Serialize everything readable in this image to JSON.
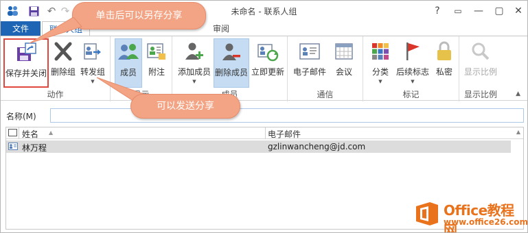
{
  "window": {
    "title": "未命名 - 联系人组",
    "controls": [
      "?",
      "▭",
      "—",
      "▢",
      "✕"
    ]
  },
  "tabs": {
    "file": "文件",
    "active": "联系人组",
    "review": "审阅"
  },
  "ribbon": {
    "groups": {
      "actions": {
        "label": "动作",
        "save_close": "保存并关闭",
        "delete_group": "删除组",
        "forward_group": "转发组"
      },
      "show": {
        "label": "显示",
        "members": "成员",
        "notes": "附注"
      },
      "members": {
        "label": "成员",
        "add_member": "添加成员",
        "remove_member": "删除成员",
        "update_now": "立即更新"
      },
      "communicate": {
        "label": "通信",
        "email": "电子邮件",
        "meeting": "会议"
      },
      "tags": {
        "label": "标记",
        "categorize": "分类",
        "follow_up": "后续标志",
        "private": "私密"
      },
      "zoom": {
        "label": "显示比例",
        "zoom_btn": "显示比例"
      }
    }
  },
  "name_field": {
    "label": "名称(M)",
    "value": ""
  },
  "members_list": {
    "headers": [
      "姓名",
      "电子邮件"
    ],
    "rows": [
      {
        "name": "林万程",
        "email": "gzlinwancheng@jd.com"
      }
    ]
  },
  "callouts": {
    "save_share": "单击后可以另存分享",
    "send_share": "可以发送分享"
  },
  "watermark": {
    "brand": "Office教程网",
    "url": "www.office26.com"
  },
  "colors": {
    "file_tab": "#1f65b5",
    "callout": "#f2a484",
    "highlight": "#e0473c",
    "selected": "#c5dcf3",
    "watermark": "#e8731c"
  }
}
